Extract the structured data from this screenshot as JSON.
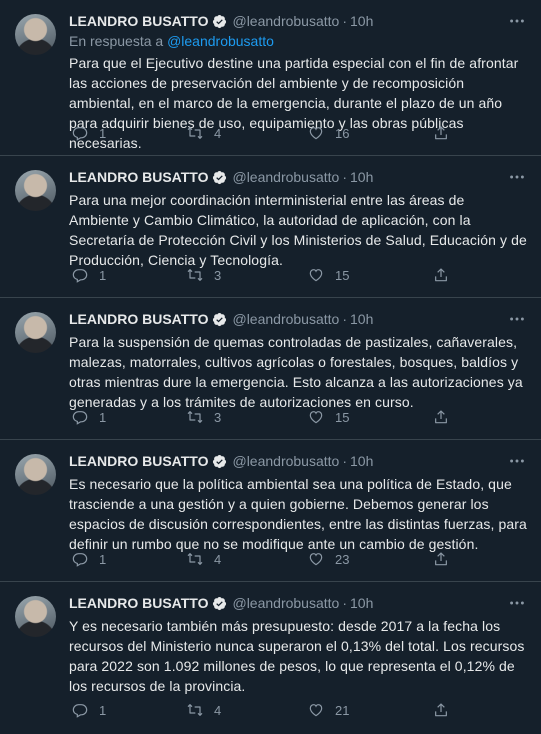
{
  "colors": {
    "background": "#15202b",
    "text": "#e7e9ea",
    "muted": "#8b98a5",
    "link": "#1d9bf0",
    "divider": "#38444d"
  },
  "tweets": [
    {
      "name": "LEANDRO BUSATTO",
      "handle": "@leandrobusatto",
      "dot": "·",
      "time": "10h",
      "reply_prefix": "En respuesta a",
      "reply_handle": "@leandrobusatto",
      "text": "Para que el Ejecutivo destine una partida especial con el fin de afrontar las acciones de preservación del ambiente y de recomposición ambiental, en el marco de la emergencia, durante el plazo de un año para adquirir bienes de uso, equipamiento y las obras públicas necesarias.",
      "replies": "1",
      "retweets": "4",
      "likes": "16"
    },
    {
      "name": "LEANDRO BUSATTO",
      "handle": "@leandrobusatto",
      "dot": "·",
      "time": "10h",
      "text": "Para una mejor coordinación interministerial entre las áreas de Ambiente y Cambio Climático, la autoridad de aplicación, con la Secretaría de Protección Civil y los Ministerios de Salud, Educación y de Producción, Ciencia y Tecnología.",
      "replies": "1",
      "retweets": "3",
      "likes": "15"
    },
    {
      "name": "LEANDRO BUSATTO",
      "handle": "@leandrobusatto",
      "dot": "·",
      "time": "10h",
      "text": "Para la suspensión de quemas controladas de pastizales, cañaverales, malezas, matorrales, cultivos agrícolas o forestales, bosques, baldíos y otras mientras dure la emergencia. Esto alcanza a las autorizaciones ya generadas y a los trámites de autorizaciones en curso.",
      "replies": "1",
      "retweets": "3",
      "likes": "15"
    },
    {
      "name": "LEANDRO BUSATTO",
      "handle": "@leandrobusatto",
      "dot": "·",
      "time": "10h",
      "text": "Es necesario que la política ambiental sea una política de Estado, que trasciende a una gestión y a quien gobierne. Debemos generar los espacios de discusión correspondientes, entre las distintas fuerzas, para definir un rumbo que no se modifique ante un cambio de gestión.",
      "replies": "1",
      "retweets": "4",
      "likes": "23"
    },
    {
      "name": "LEANDRO BUSATTO",
      "handle": "@leandrobusatto",
      "dot": "·",
      "time": "10h",
      "text": "Y es necesario también más presupuesto: desde 2017 a la fecha los recursos del Ministerio nunca superaron el 0,13% del total. Los recursos para 2022 son 1.092 millones de pesos, lo que representa el 0,12% de los recursos de la provincia.",
      "replies": "1",
      "retweets": "4",
      "likes": "21"
    }
  ]
}
